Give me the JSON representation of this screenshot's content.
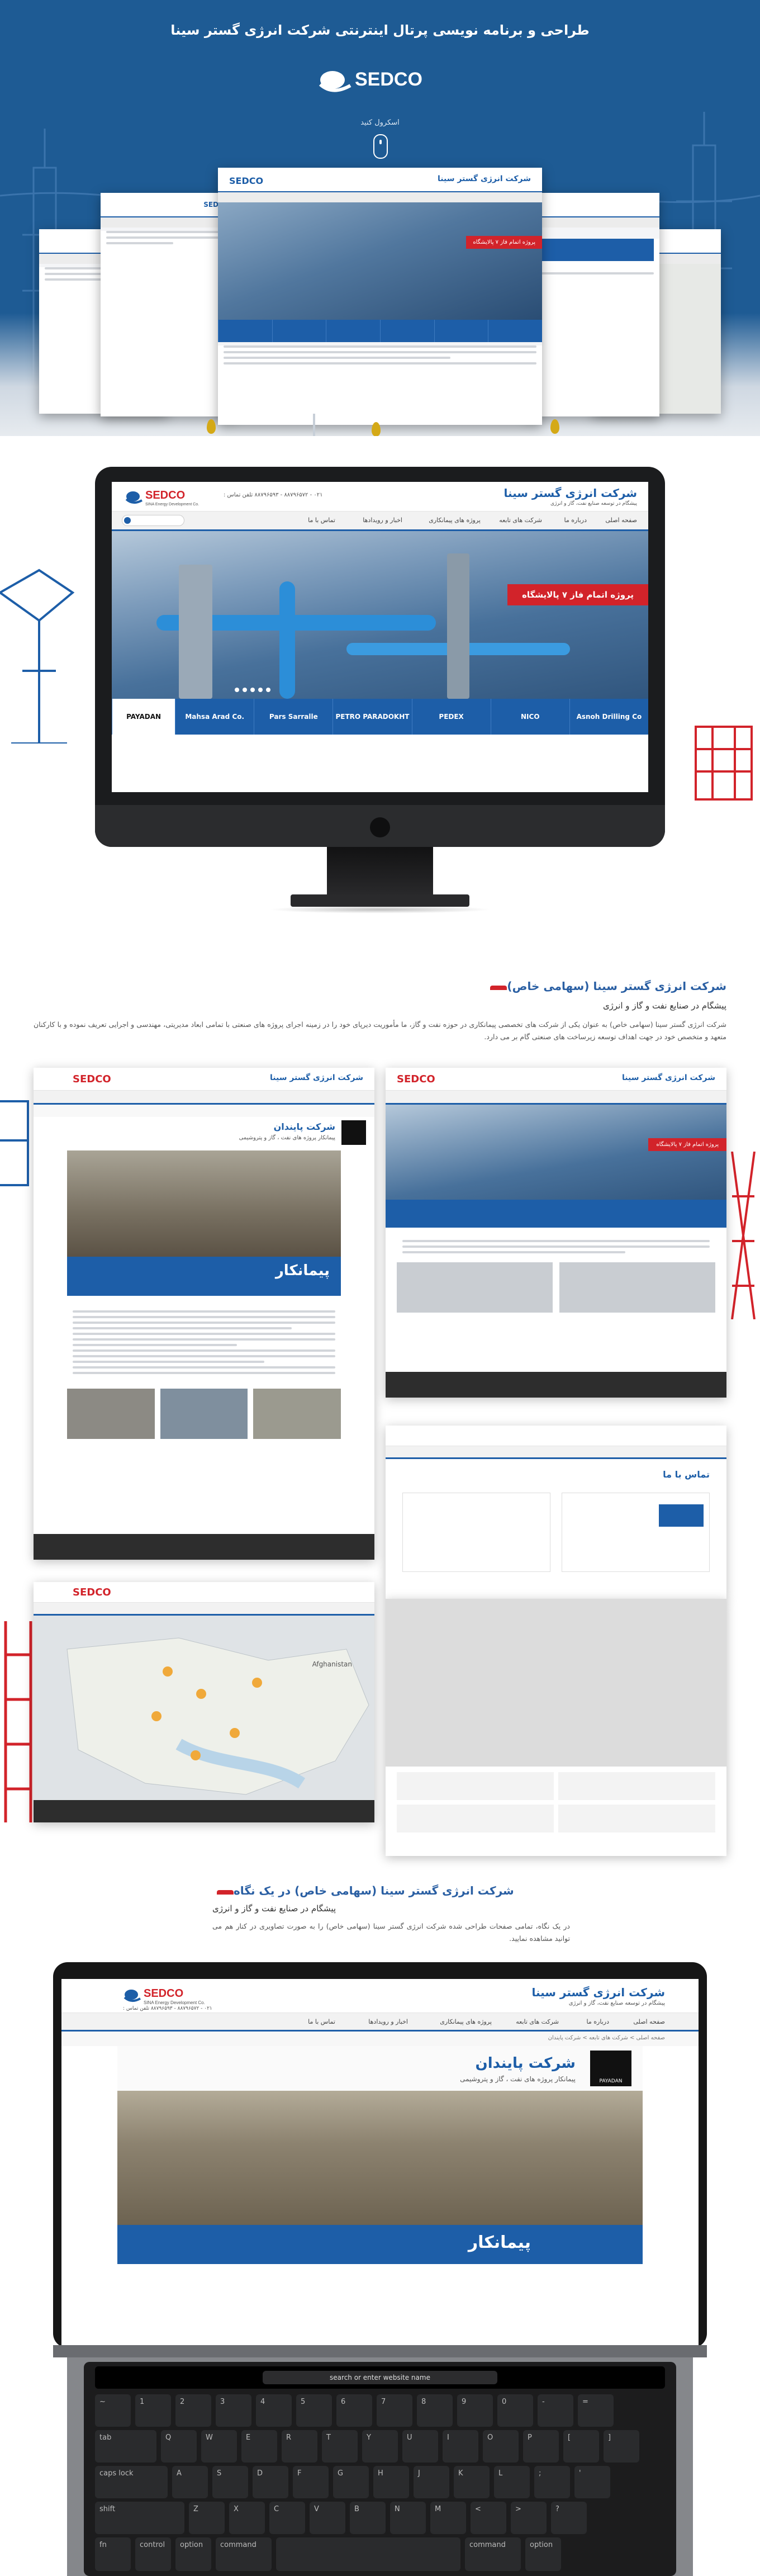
{
  "hero": {
    "title": "طراحی و برنامه نویسی پرتال اینترنتی شرکت انرژی گستر سینا",
    "logo_text": "SEDCO",
    "scroll_hint": "اسکرول کنید"
  },
  "site": {
    "brand_fa": "شرکت انرژی گستر سینا",
    "brand_tagline": "پیشگام در توسعه صنایع نفت، گاز و انرژی",
    "logo_text": "SEDCO",
    "logo_sub": "SINA Energy Development Co.",
    "phone": "۰۲۱ - ۸۸۷۹۶۵۷۲ - ۸۸۷۹۶۵۹۳ تلفن تماس :",
    "nav": [
      "صفحه اصلی",
      "درباره ما",
      "شرکت های تابعه",
      "پروژه های پیمانکاری",
      "اخبار و رویدادها",
      "تماس با ما"
    ],
    "slider_caption": "پروژه اتمام فاز ۷ پالایشگاه",
    "partners": [
      "Mahsa Arad Co.",
      "Pars Sarralle",
      "PETRO PARADOKHT",
      "PEDEX",
      "NICO",
      "Asnoh Drilling Co"
    ],
    "paiadan": "PAYADAN",
    "peymankar": "پیمانکار"
  },
  "about": {
    "title": "شرکت انرژی گستر سینا (سهامی خاص)",
    "subtitle": "پیشگام در صنایع نفت و گاز و انرژی",
    "body": "شرکت انرژی گستر سینا (سهامی خاص) به عنوان یکی از شرکت های تخصصی پیمانکاری در حوزه نفت و گاز، ما مأموریت دیرپای خود را در زمینه اجرای پروژه های صنعتی با تمامی ابعاد مدیریتی، مهندسی و اجرایی تعریف نموده و با کارکنان متعهد و متخصص خود در جهت اهداف توسعه زیرساخت های صنعتی گام بر می دارد."
  },
  "glance": {
    "title": "شرکت انرژی گستر سینا (سهامی خاص) در یک نگاه",
    "subtitle": "پیشگام در صنایع نفت و گاز و انرژی",
    "body": "در یک نگاه، تمامی صفحات طراحی شده شرکت انرژی گستر سینا (سهامی خاص) را به صورت تصاویری در کنار هم می توانید مشاهده نمایید."
  },
  "pages": {
    "company_title": "شرکت پایندان",
    "company_sub": "پیمانکار پروژه های نفت ، گاز و پتروشیمی",
    "contact_title": "تماس با ما",
    "map_label": "Afghanistan"
  },
  "laptop": {
    "breadcrumb": "صفحه اصلی > شرکت های تابعه > شرکت پایندان",
    "company_title": "شرکت پایندان",
    "company_sub": "پیمانکار پروژه های نفت ، گاز و پتروشیمی",
    "peymankar": "پیمانکار",
    "touchbar_search": "search or enter website name",
    "keys_row1": [
      "~",
      "1",
      "2",
      "3",
      "4",
      "5",
      "6",
      "7",
      "8",
      "9",
      "0",
      "-",
      "=",
      "delete"
    ],
    "keys_row2": [
      "tab",
      "Q",
      "W",
      "E",
      "R",
      "T",
      "Y",
      "U",
      "I",
      "O",
      "P",
      "[",
      "]",
      "\\"
    ],
    "keys_row3": [
      "caps lock",
      "A",
      "S",
      "D",
      "F",
      "G",
      "H",
      "J",
      "K",
      "L",
      ";",
      "'",
      "return"
    ],
    "keys_row4": [
      "shift",
      "Z",
      "X",
      "C",
      "V",
      "B",
      "N",
      "M",
      "<",
      ">",
      "?",
      "shift"
    ],
    "keys_row5": [
      "fn",
      "control",
      "option",
      "command",
      "",
      "command",
      "option"
    ]
  },
  "colors": {
    "brand_blue": "#1d5ea8",
    "hero_blue": "#1e5b94",
    "accent_red": "#d2232a",
    "title_blue": "#2a5fa3"
  }
}
